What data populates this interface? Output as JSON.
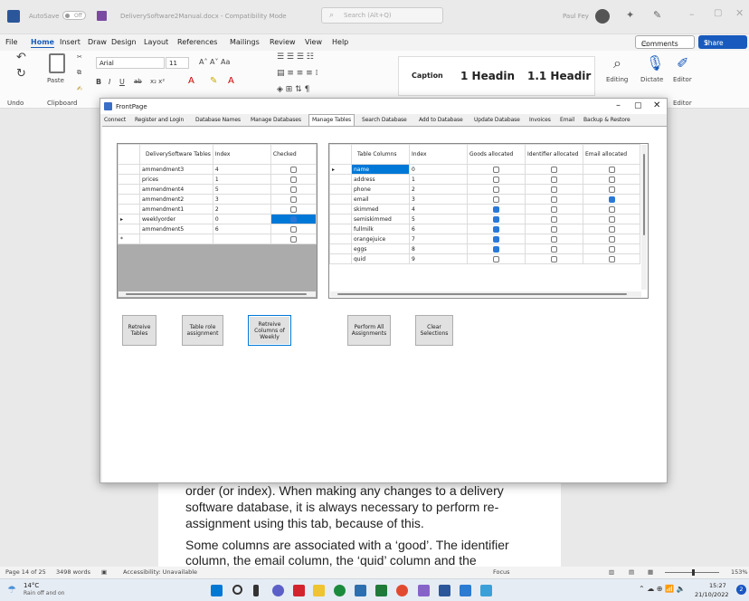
{
  "word": {
    "autosave_label": "AutoSave",
    "autosave_state": "Off",
    "doc_title": "DeliverySoftware2Manual.docx  -  Compatibility Mode",
    "search_placeholder": "Search (Alt+Q)",
    "user_name": "Paul Fey",
    "menu": [
      "File",
      "Home",
      "Insert",
      "Draw",
      "Design",
      "Layout",
      "References",
      "Mailings",
      "Review",
      "View",
      "Help"
    ],
    "comments_label": "Comments",
    "share_label": "Share",
    "ribbon": {
      "undo_label": "Undo",
      "paste_label": "Paste",
      "clipboard_label": "Clipboard",
      "font_name": "Arial",
      "font_size": "11",
      "style_caption": "Caption",
      "style_h1": "1  Headin",
      "style_h11": "1.1  Headir",
      "editing_label": "Editing",
      "dictate_label": "Dictate",
      "editor_label": "Editor",
      "editor_group_label": "Editor"
    },
    "doc_lines": [
      "order (or index). When making any changes to a delivery",
      "software database, it is always necessary to perform re-",
      "assignment using this tab, because of this.",
      "Some columns are associated with a ‘good’. The identifier",
      "column, the email column, the ‘quid’ column and the"
    ],
    "status": {
      "page": "Page 14 of 25",
      "words": "3498 words",
      "accessibility": "Accessibility: Unavailable",
      "focus": "Focus",
      "zoom": "153%"
    },
    "taskbar": {
      "temp": "14°C",
      "weather": "Rain off and on",
      "time": "15:27",
      "date": "21/10/2022",
      "badge": "2"
    }
  },
  "dialog": {
    "title": "FrontPage",
    "tabs": [
      "Connect",
      "Register and Login",
      "Database Names",
      "Manage Databases",
      "Manage Tables",
      "Search Database",
      "Add to Database",
      "Update Database",
      "Invoices",
      "Email",
      "Backup & Restore"
    ],
    "active_tab": "Manage Tables",
    "left_grid": {
      "headers": [
        "DeliverySoftware Tables",
        "Index",
        "Checked"
      ],
      "rows": [
        {
          "name": "ammendment3",
          "index": "4",
          "checked": false
        },
        {
          "name": "prices",
          "index": "1",
          "checked": false
        },
        {
          "name": "ammendment4",
          "index": "5",
          "checked": false
        },
        {
          "name": "ammendment2",
          "index": "3",
          "checked": false
        },
        {
          "name": "ammendment1",
          "index": "2",
          "checked": false
        },
        {
          "name": "weeklyorder",
          "index": "0",
          "checked": true
        },
        {
          "name": "ammendment5",
          "index": "6",
          "checked": false
        }
      ]
    },
    "right_grid": {
      "headers": [
        "Table Columns",
        "Index",
        "Goods allocated",
        "Identifier allocated",
        "Email allocated"
      ],
      "rows": [
        {
          "name": "name",
          "index": "0",
          "goods": false,
          "ident": false,
          "email": false
        },
        {
          "name": "address",
          "index": "1",
          "goods": false,
          "ident": false,
          "email": false
        },
        {
          "name": "phone",
          "index": "2",
          "goods": false,
          "ident": false,
          "email": false
        },
        {
          "name": "email",
          "index": "3",
          "goods": false,
          "ident": false,
          "email": true
        },
        {
          "name": "skimmed",
          "index": "4",
          "goods": true,
          "ident": false,
          "email": false
        },
        {
          "name": "semiskimmed",
          "index": "5",
          "goods": true,
          "ident": false,
          "email": false
        },
        {
          "name": "fullmilk",
          "index": "6",
          "goods": true,
          "ident": false,
          "email": false
        },
        {
          "name": "orangejuice",
          "index": "7",
          "goods": true,
          "ident": false,
          "email": false
        },
        {
          "name": "eggs",
          "index": "8",
          "goods": true,
          "ident": false,
          "email": false
        },
        {
          "name": "quid",
          "index": "9",
          "goods": false,
          "ident": false,
          "email": false
        }
      ]
    },
    "buttons": [
      "Retreive Tables",
      "Table role assignment",
      "Retreive Columns of Weekly",
      "Perform All Assignments",
      "Clear Selections"
    ]
  }
}
